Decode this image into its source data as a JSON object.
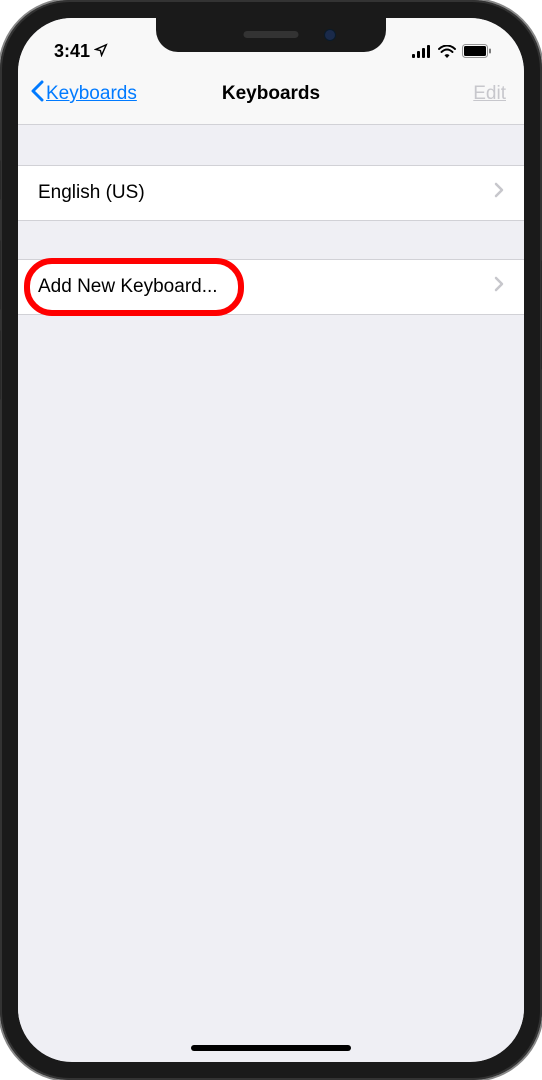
{
  "status": {
    "time": "3:41",
    "location_icon": "location-arrow"
  },
  "nav": {
    "back_label": "Keyboards",
    "title": "Keyboards",
    "edit_label": "Edit"
  },
  "rows": {
    "keyboard_0": "English (US)",
    "add_new": "Add New Keyboard..."
  }
}
